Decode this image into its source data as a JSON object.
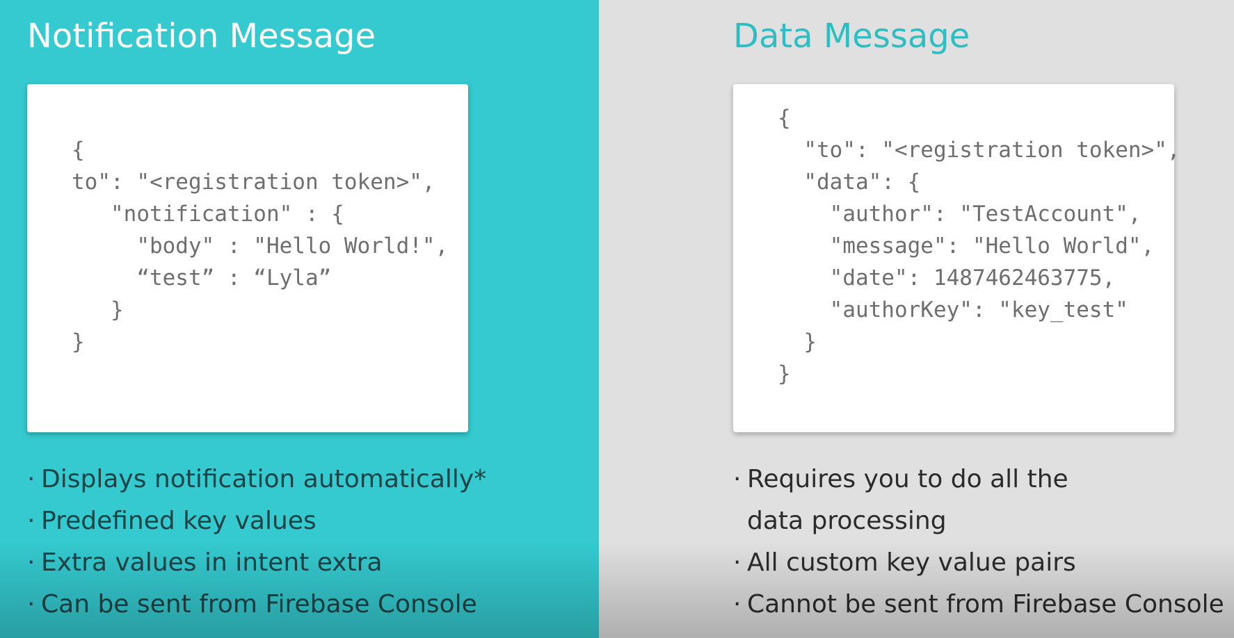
{
  "left": {
    "title": "Notification Message",
    "code_lines": [
      "{",
      "to\": \"<registration token>\",",
      "   \"notification\" : {",
      "     \"body\" : \"Hello World!\",",
      "     “test” : “Lyla”",
      "   }",
      "}"
    ],
    "bullets": [
      "Displays notification automatically*",
      "Predefined key values",
      "Extra values in intent extra",
      "Can be sent from Firebase Console"
    ]
  },
  "right": {
    "title": "Data Message",
    "code_lines": [
      "{",
      "  \"to\": \"<registration token>\",",
      "  \"data\": {",
      "    \"author\": \"TestAccount\",",
      "    \"message\": \"Hello World\",",
      "    \"date\": 1487462463775,",
      "    \"authorKey\": \"key_test\"",
      "  }",
      "}"
    ],
    "bullets": [
      "Requires you to do all the",
      "data processing",
      "All custom key value pairs",
      "Cannot be sent from Firebase Console"
    ]
  },
  "colors": {
    "left_background": "#34cacf",
    "right_background": "#e0e0e0",
    "right_title": "#2cbec3"
  }
}
